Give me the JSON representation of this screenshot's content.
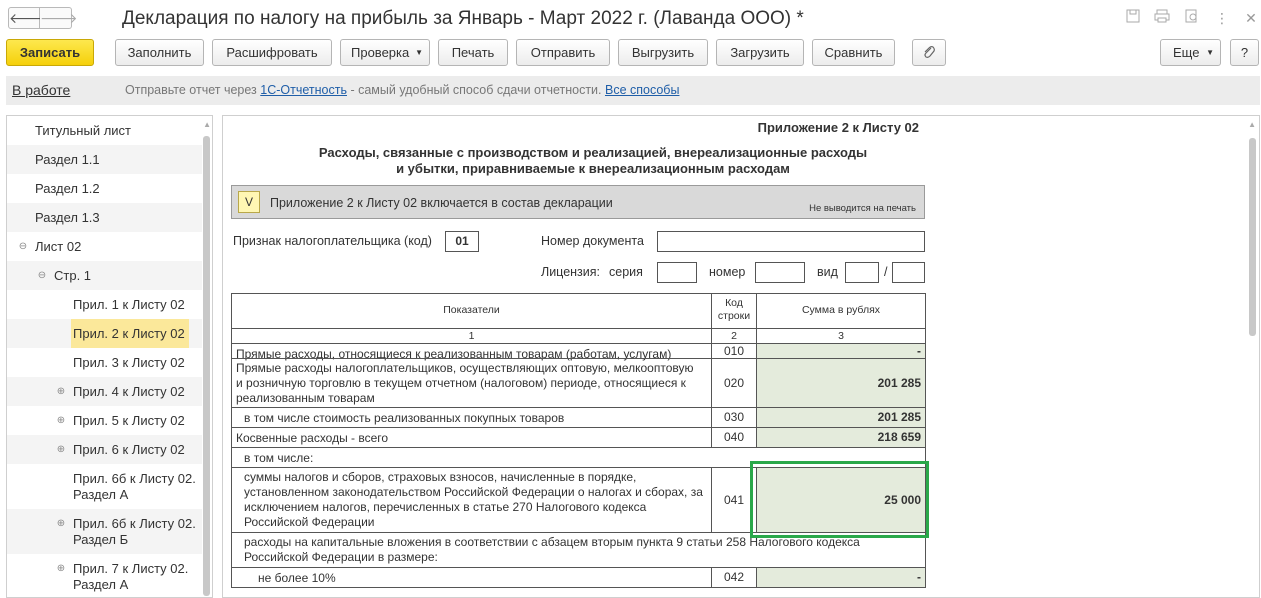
{
  "window": {
    "title": "Декларация по налогу на прибыль за Январь - Март 2022 г. (Лаванда ООО) *",
    "back_icon": "arrow-left",
    "forward_icon": "arrow-right"
  },
  "toolbar": {
    "save": "Записать",
    "fill": "Заполнить",
    "decode": "Расшифровать",
    "check": "Проверка",
    "print": "Печать",
    "send": "Отправить",
    "export": "Выгрузить",
    "import": "Загрузить",
    "compare": "Сравнить",
    "more": "Еще",
    "help": "?"
  },
  "infobar": {
    "status": "В работе",
    "text_before": "Отправьте отчет через ",
    "link1": "1С-Отчетность",
    "text_middle": " - самый удобный способ сдачи отчетности. ",
    "link2": "Все способы"
  },
  "tree": {
    "items": [
      {
        "label": "Титульный лист"
      },
      {
        "label": "Раздел 1.1"
      },
      {
        "label": "Раздел 1.2"
      },
      {
        "label": "Раздел 1.3"
      },
      {
        "label": "Лист 02",
        "toggle": "⊖"
      },
      {
        "label": "Стр. 1",
        "toggle": "⊖"
      },
      {
        "label": "Прил. 1 к Листу 02"
      },
      {
        "label": "Прил. 2 к Листу 02",
        "selected": true
      },
      {
        "label": "Прил. 3 к Листу 02"
      },
      {
        "label": "Прил. 4 к Листу 02",
        "toggle": "⊕"
      },
      {
        "label": "Прил. 5 к Листу 02",
        "toggle": "⊕"
      },
      {
        "label": "Прил. 6 к Листу 02",
        "toggle": "⊕"
      },
      {
        "label": "Прил. 6б к Листу 02. Раздел А"
      },
      {
        "label": "Прил. 6б к Листу 02. Раздел Б",
        "toggle": "⊕"
      },
      {
        "label": "Прил. 7 к Листу 02. Раздел А",
        "toggle": "⊕"
      }
    ]
  },
  "form": {
    "appendix_title": "Приложение 2 к Листу 02",
    "title_line1": "Расходы, связанные с производством и реализацией, внереализационные расходы",
    "title_line2": "и убытки, приравниваемые к внереализационным расходам",
    "include_checkbox": "V",
    "include_text": "Приложение 2 к Листу 02 включается в состав декларации",
    "not_printed": "Не выводится на печать",
    "taxpayer_sign_label": "Признак налогоплательщика (код)",
    "taxpayer_sign_value": "01",
    "doc_number_label": "Номер документа",
    "doc_number_value": "",
    "license_label": "Лицензия:",
    "series_label": "серия",
    "number_label": "номер",
    "type_label": "вид",
    "slash": "/"
  },
  "table": {
    "headers": {
      "col1": "Показатели",
      "col2": "Код строки",
      "col3": "Сумма в рублях"
    },
    "col_numbers": [
      "1",
      "2",
      "3"
    ],
    "rows": [
      {
        "label": "Прямые расходы, относящиеся к реализованным товарам (работам, услугам)",
        "code": "010",
        "value": "-"
      },
      {
        "label": "Прямые расходы налогоплательщиков, осуществляющих оптовую, мелкооптовую и розничную торговлю в текущем отчетном (налоговом) периоде, относящиеся к реализованным товарам",
        "code": "020",
        "value": "201 285"
      },
      {
        "label": "в том числе стоимость реализованных покупных товаров",
        "code": "030",
        "value": "201 285"
      },
      {
        "label": "Косвенные расходы - всего",
        "code": "040",
        "value": "218 659"
      },
      {
        "label": "в том числе:",
        "code": "",
        "value": ""
      },
      {
        "label": "суммы налогов и сборов, страховых взносов, начисленные в порядке, установленном законодательством Российской Федерации о налогах и сборах, за исключением налогов, перечисленных в статье 270 Налогового кодекса Российской Федерации",
        "code": "041",
        "value": "25 000"
      },
      {
        "label": "расходы на капитальные вложения в соответствии с абзацем вторым пункта 9 статьи 258 Налогового кодекса Российской Федерации в размере:",
        "code": "",
        "value": ""
      },
      {
        "label": "не более 10%",
        "code": "042",
        "value": "-"
      }
    ]
  },
  "icons": {
    "save_doc": "floppy-icon",
    "printer": "printer-icon",
    "preview": "preview-icon",
    "more_vert": "kebab-icon",
    "close": "close-icon",
    "attach": "paperclip-icon"
  },
  "colors": {
    "primary_button": "#f5d00a",
    "selected_tree": "#fbe89a",
    "value_cell": "#e4ebdc",
    "focus_frame": "#2aa84a",
    "link": "#1f5ea8"
  }
}
